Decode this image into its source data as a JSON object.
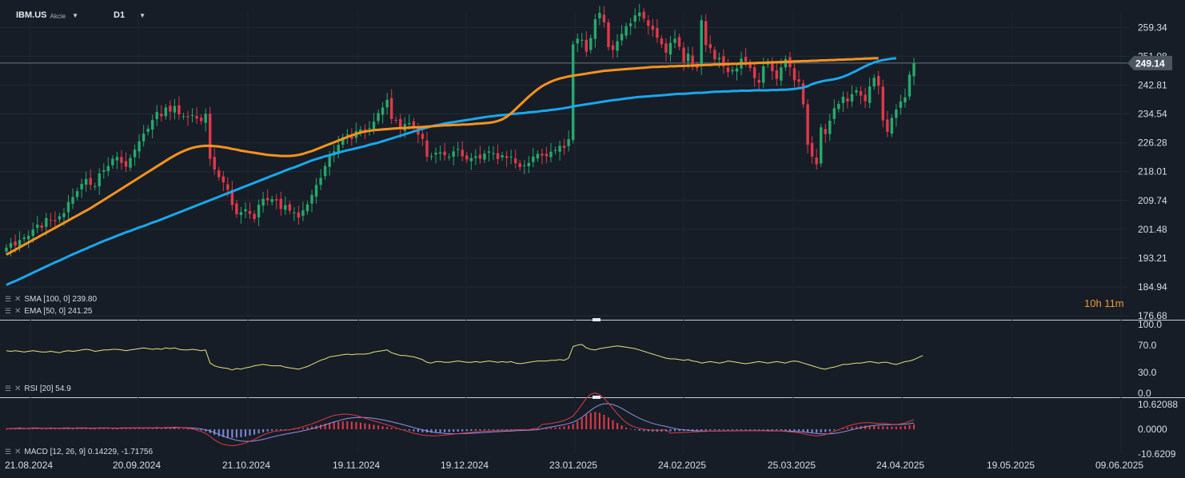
{
  "toolbar": {
    "symbol": "IBM.US",
    "asset_type": "Akcie",
    "timeframe": "D1"
  },
  "countdown": "10h 11m",
  "indicators": {
    "sma": "SMA [100, 0] 239.80",
    "ema": "EMA [50, 0] 241.25",
    "rsi": "RSI [20] 54.9",
    "macd": "MACD [12, 26, 9] 0.14229, -1.71756"
  },
  "colors": {
    "background": "#161d26",
    "up": "#26a96c",
    "down": "#e0384a",
    "sma": "#1aa7ec",
    "ema": "#f7931e",
    "rsi": "#e8e07a",
    "macd_line": "#e0384a",
    "signal_line": "#8f92e6",
    "hist_pos": "#e0384a",
    "hist_neg": "#7f86d6"
  },
  "chart_data": [
    {
      "type": "candlestick",
      "symbol": "IBM.US",
      "timeframe": "D1",
      "ylim": [
        176.68,
        264
      ],
      "y_ticks": [
        "259.34",
        "251.08",
        "242.81",
        "234.54",
        "226.28",
        "218.01",
        "209.74",
        "201.48",
        "193.21",
        "184.94",
        "176.68"
      ],
      "x_ticks": [
        "21.08.2024",
        "20.09.2024",
        "21.10.2024",
        "19.11.2024",
        "19.12.2024",
        "23.01.2025",
        "24.02.2025",
        "25.03.2025",
        "24.04.2025",
        "19.05.2025",
        "09.06.2025"
      ],
      "last_price": "249.14",
      "price_line": 249.14,
      "closes": [
        196.2,
        197.5,
        196.8,
        198.4,
        199.1,
        199.6,
        201.4,
        202.8,
        201.9,
        204.7,
        204.1,
        203.8,
        205.2,
        206.1,
        209.3,
        210.7,
        212.4,
        214.5,
        215.9,
        214.2,
        213.8,
        217.5,
        218.4,
        219.6,
        221.7,
        222.2,
        220.5,
        219.4,
        221.9,
        224.3,
        226.7,
        228.9,
        230.3,
        232.8,
        235.1,
        233.9,
        236.4,
        235.2,
        236.8,
        234.4,
        233.9,
        233.6,
        234.2,
        233.2,
        232.5,
        234.6,
        221.7,
        218.6,
        216.4,
        214.9,
        212.8,
        208.4,
        205.8,
        206.4,
        207.2,
        205.9,
        204.4,
        208.5,
        210.2,
        209.8,
        210.1,
        209.7,
        207.3,
        208.4,
        206.8,
        206.3,
        204.8,
        206.9,
        208.6,
        211.3,
        214.2,
        216.2,
        219.6,
        222.4,
        223.8,
        225.7,
        227.9,
        228.7,
        227.4,
        229.6,
        230.1,
        229.8,
        230.5,
        232.3,
        234.8,
        236.4,
        238.6,
        233.1,
        232.8,
        230.2,
        231.6,
        231.9,
        230.7,
        228.6,
        227.4,
        222.3,
        222.4,
        223.4,
        223.5,
        222.7,
        222.3,
        223.8,
        224.5,
        222.4,
        221.5,
        221.9,
        222.4,
        221.7,
        223.2,
        223.8,
        223.3,
        221.6,
        222.7,
        221.9,
        222.3,
        220.4,
        219.3,
        219.8,
        220.5,
        222.3,
        223.1,
        222.6,
        222.4,
        223.7,
        224.2,
        225.4,
        224.8,
        227.3,
        254.5,
        256.1,
        255.8,
        252.4,
        256.3,
        261.7,
        263.5,
        260.8,
        253.7,
        252.9,
        255.4,
        257.5,
        259.7,
        260.5,
        262.8,
        263.6,
        261.9,
        259.8,
        258.7,
        256.4,
        254.5,
        252.1,
        254.9,
        256.1,
        253.8,
        249.4,
        251.8,
        248.5,
        247.7,
        261.4,
        254.3,
        253.4,
        250.2,
        250.6,
        248.1,
        246.5,
        247.2,
        247.6,
        250.4,
        249.5,
        247.7,
        244.8,
        243.5,
        248.2,
        249.5,
        246.8,
        244.6,
        247.9,
        250.3,
        247.9,
        244.2,
        243.8,
        237.3,
        225.7,
        222.3,
        220.1,
        230.7,
        228.8,
        232.6,
        236.2,
        237.4,
        239.5,
        238.1,
        240.2,
        241.3,
        239.8,
        238.2,
        242.4,
        244.9,
        242.6,
        232.7,
        229.4,
        233.4,
        235.8,
        238.1,
        239.3,
        245.8,
        249.14
      ],
      "sma_100": [
        185.5,
        186.1,
        186.6,
        187.2,
        187.8,
        188.4,
        189.0,
        189.6,
        190.2,
        190.8,
        191.4,
        192.0,
        192.5,
        193.1,
        193.7,
        194.3,
        194.8,
        195.4,
        195.9,
        196.5,
        197.0,
        197.6,
        198.1,
        198.6,
        199.1,
        199.6,
        200.1,
        200.6,
        201.0,
        201.5,
        202.0,
        202.4,
        202.9,
        203.4,
        203.8,
        204.3,
        204.8,
        205.3,
        205.8,
        206.3,
        206.8,
        207.3,
        207.8,
        208.3,
        208.8,
        209.3,
        209.8,
        210.3,
        210.8,
        211.3,
        211.8,
        212.3,
        212.8,
        213.3,
        213.8,
        214.3,
        214.8,
        215.3,
        215.8,
        216.3,
        216.8,
        217.3,
        217.8,
        218.3,
        218.8,
        219.2,
        219.7,
        220.2,
        220.7,
        221.2,
        221.6,
        222.0,
        222.4,
        222.7,
        223.1,
        223.4,
        223.8,
        224.1,
        224.4,
        224.7,
        225.0,
        225.3,
        225.7,
        226.0,
        226.3,
        226.7,
        227.1,
        227.5,
        227.9,
        228.3,
        228.7,
        229.1,
        229.5,
        229.9,
        230.3,
        230.6,
        231.0,
        231.3,
        231.5,
        231.8,
        232.0,
        232.2,
        232.4,
        232.6,
        232.8,
        233.0,
        233.2,
        233.4,
        233.6,
        233.8,
        233.9,
        234.1,
        234.2,
        234.3,
        234.5,
        234.6,
        234.7,
        234.8,
        235.0,
        235.1,
        235.2,
        235.4,
        235.5,
        235.7,
        235.8,
        236.0,
        236.2,
        236.4,
        236.7,
        236.9,
        237.1,
        237.3,
        237.5,
        237.7,
        237.9,
        238.1,
        238.3,
        238.5,
        238.6,
        238.8,
        239.0,
        239.1,
        239.3,
        239.4,
        239.5,
        239.6,
        239.7,
        239.8,
        239.9,
        240.0,
        240.1,
        240.2,
        240.3,
        240.3,
        240.4,
        240.5,
        240.6,
        240.6,
        240.7,
        240.8,
        240.9,
        240.9,
        241.0,
        241.0,
        241.1,
        241.1,
        241.2,
        241.2,
        241.2,
        241.3,
        241.3,
        241.3,
        241.3,
        241.4,
        241.4,
        241.5,
        241.5,
        241.6,
        241.7,
        241.9,
        242.1,
        242.5,
        243.1,
        243.5,
        243.8,
        244.1,
        244.3,
        244.5,
        244.8,
        245.2,
        245.7,
        246.3,
        246.9,
        247.6,
        248.2,
        248.8,
        249.3,
        249.7,
        250.0,
        250.2,
        250.4,
        250.5
      ],
      "ema_50": [
        194.2,
        194.9,
        195.6,
        196.3,
        197.0,
        197.7,
        198.4,
        199.1,
        199.8,
        200.5,
        201.2,
        201.9,
        202.6,
        203.3,
        204.0,
        204.7,
        205.4,
        206.1,
        206.8,
        207.5,
        208.3,
        209.1,
        209.9,
        210.7,
        211.5,
        212.3,
        213.1,
        213.9,
        214.7,
        215.5,
        216.3,
        217.1,
        217.9,
        218.7,
        219.5,
        220.3,
        221.1,
        221.9,
        222.6,
        223.3,
        223.9,
        224.4,
        224.8,
        225.1,
        225.3,
        225.4,
        225.4,
        225.3,
        225.2,
        225.0,
        224.8,
        224.5,
        224.3,
        224.0,
        223.8,
        223.6,
        223.4,
        223.2,
        223.0,
        222.8,
        222.7,
        222.6,
        222.5,
        222.5,
        222.5,
        222.6,
        222.8,
        223.1,
        223.5,
        223.9,
        224.4,
        224.9,
        225.4,
        225.9,
        226.4,
        226.9,
        227.4,
        227.9,
        228.4,
        228.8,
        229.2,
        229.5,
        229.7,
        229.9,
        230.0,
        230.1,
        230.2,
        230.3,
        230.4,
        230.5,
        230.5,
        230.6,
        230.7,
        230.7,
        230.8,
        230.9,
        231.0,
        231.1,
        231.2,
        231.3,
        231.3,
        231.4,
        231.4,
        231.5,
        231.5,
        231.6,
        231.7,
        231.8,
        231.9,
        232.0,
        232.2,
        232.5,
        233.0,
        233.7,
        234.7,
        235.9,
        237.1,
        238.3,
        239.5,
        240.6,
        241.6,
        242.5,
        243.2,
        243.8,
        244.3,
        244.7,
        245.0,
        245.3,
        245.5,
        245.7,
        245.9,
        246.1,
        246.3,
        246.5,
        246.7,
        246.9,
        247.0,
        247.1,
        247.2,
        247.3,
        247.4,
        247.5,
        247.6,
        247.7,
        247.8,
        247.9,
        248.0,
        248.0,
        248.1,
        248.1,
        248.2,
        248.2,
        248.3,
        248.3,
        248.4,
        248.4,
        248.5,
        248.5,
        248.6,
        248.6,
        248.7,
        248.7,
        248.8,
        248.8,
        248.9,
        248.9,
        249.0,
        249.0,
        249.1,
        249.1,
        249.2,
        249.2,
        249.3,
        249.3,
        249.4,
        249.4,
        249.5,
        249.5,
        249.6,
        249.6,
        249.7,
        249.7,
        249.8,
        249.8,
        249.9,
        249.9,
        250.0,
        250.0,
        250.1,
        250.1,
        250.2,
        250.2,
        250.3,
        250.3,
        250.4,
        250.4,
        250.5,
        250.5
      ]
    },
    {
      "type": "line",
      "name": "RSI [20]",
      "ylim": [
        0,
        100
      ],
      "y_ticks": [
        "100.0",
        "70.0",
        "30.0",
        "0.0"
      ],
      "values": [
        62,
        61,
        62,
        61,
        60,
        61,
        62,
        61,
        60,
        60,
        61,
        60,
        59,
        61,
        62,
        61,
        62,
        63,
        64,
        63,
        61,
        62,
        63,
        63,
        64,
        64,
        63,
        62,
        63,
        64,
        65,
        66,
        65,
        64,
        65,
        64,
        66,
        65,
        66,
        64,
        63,
        63,
        64,
        63,
        62,
        63,
        44,
        40,
        38,
        37,
        36,
        34,
        36,
        35,
        37,
        38,
        40,
        41,
        42,
        41,
        40,
        40,
        40,
        38,
        37,
        36,
        35,
        37,
        39,
        42,
        45,
        48,
        50,
        53,
        54,
        55,
        56,
        57,
        56,
        57,
        57,
        57,
        58,
        60,
        61,
        62,
        63,
        59,
        57,
        55,
        55,
        54,
        53,
        51,
        49,
        45,
        44,
        46,
        46,
        45,
        45,
        46,
        47,
        46,
        45,
        45,
        46,
        45,
        46,
        47,
        46,
        45,
        46,
        45,
        46,
        44,
        43,
        44,
        45,
        46,
        47,
        47,
        47,
        48,
        48,
        49,
        48,
        51,
        68,
        70,
        71,
        66,
        64,
        63,
        65,
        66,
        67,
        68,
        69,
        68,
        67,
        66,
        65,
        63,
        61,
        59,
        57,
        55,
        53,
        51,
        50,
        50,
        49,
        48,
        49,
        47,
        46,
        44,
        45,
        46,
        45,
        44,
        45,
        47,
        46,
        45,
        44,
        43,
        44,
        45,
        46,
        45,
        44,
        45,
        46,
        45,
        44,
        46,
        47,
        46,
        44,
        42,
        40,
        38,
        36,
        35,
        37,
        38,
        40,
        42,
        42,
        43,
        44,
        44,
        45,
        46,
        45,
        44,
        45,
        45,
        43,
        42,
        44,
        46,
        47,
        49,
        52,
        54.9
      ]
    },
    {
      "type": "bar+line",
      "name": "MACD [12, 26, 9]",
      "ylim": [
        -10.6209,
        10.62088
      ],
      "y_ticks": [
        "10.62088",
        "0.0000",
        "-10.6209"
      ],
      "histogram": [
        0.1,
        0.2,
        0.2,
        0.3,
        0.2,
        0.2,
        0.3,
        0.3,
        0.2,
        0.2,
        0.3,
        0.2,
        0.2,
        0.3,
        0.3,
        0.2,
        0.3,
        0.3,
        0.3,
        0.2,
        0.2,
        0.3,
        0.3,
        0.3,
        0.2,
        0.2,
        0.3,
        0.3,
        0.3,
        0.3,
        0.3,
        0.3,
        0.3,
        0.3,
        0.4,
        0.3,
        0.4,
        0.4,
        0.5,
        0.4,
        0.3,
        0.2,
        0.1,
        -0.2,
        -0.5,
        -0.9,
        -1.6,
        -2.4,
        -3.0,
        -3.4,
        -3.6,
        -3.7,
        -3.6,
        -3.4,
        -3.1,
        -2.7,
        -2.3,
        -1.8,
        -1.3,
        -0.9,
        -0.6,
        -0.4,
        -0.3,
        -0.2,
        -0.1,
        0.1,
        0.3,
        0.6,
        0.9,
        1.2,
        1.6,
        2.0,
        2.4,
        2.8,
        3.1,
        3.3,
        3.4,
        3.4,
        3.3,
        3.1,
        2.8,
        2.5,
        2.2,
        1.9,
        1.6,
        1.3,
        1.0,
        0.7,
        0.3,
        0.0,
        -0.3,
        -0.6,
        -0.9,
        -1.1,
        -1.3,
        -1.4,
        -1.5,
        -1.5,
        -1.4,
        -1.3,
        -1.2,
        -1.1,
        -1.0,
        -0.9,
        -0.8,
        -0.7,
        -0.6,
        -0.5,
        -0.4,
        -0.4,
        -0.3,
        -0.3,
        -0.2,
        -0.2,
        -0.2,
        -0.1,
        -0.1,
        -0.1,
        -0.1,
        0.1,
        0.2,
        0.3,
        0.4,
        0.5,
        0.7,
        0.9,
        1.2,
        1.6,
        2.2,
        3.4,
        4.8,
        6.2,
        7.1,
        7.4,
        7.0,
        6.2,
        5.1,
        3.9,
        2.7,
        1.6,
        0.7,
        0.1,
        -0.3,
        -0.6,
        -0.8,
        -0.9,
        -1.0,
        -1.0,
        -1.0,
        -0.9,
        -0.9,
        -0.8,
        -0.8,
        -0.7,
        -0.7,
        -0.6,
        -0.6,
        -0.5,
        -0.5,
        -0.4,
        -0.4,
        -0.4,
        -0.3,
        -0.3,
        -0.3,
        -0.3,
        -0.3,
        -0.3,
        -0.3,
        -0.3,
        -0.3,
        -0.3,
        -0.4,
        -0.4,
        -0.4,
        -0.4,
        -0.5,
        -0.6,
        -0.7,
        -0.8,
        -1.0,
        -1.2,
        -1.4,
        -1.5,
        -1.4,
        -1.2,
        -0.9,
        -0.5,
        -0.1,
        0.3,
        0.7,
        1.0,
        1.2,
        1.4,
        1.5,
        1.5,
        1.4,
        1.3,
        1.3,
        1.2,
        1.1,
        1.1,
        1.2,
        1.4,
        1.8,
        2.1
      ],
      "macd_line_end": 0.14229,
      "signal_line_end": -1.71756
    }
  ]
}
